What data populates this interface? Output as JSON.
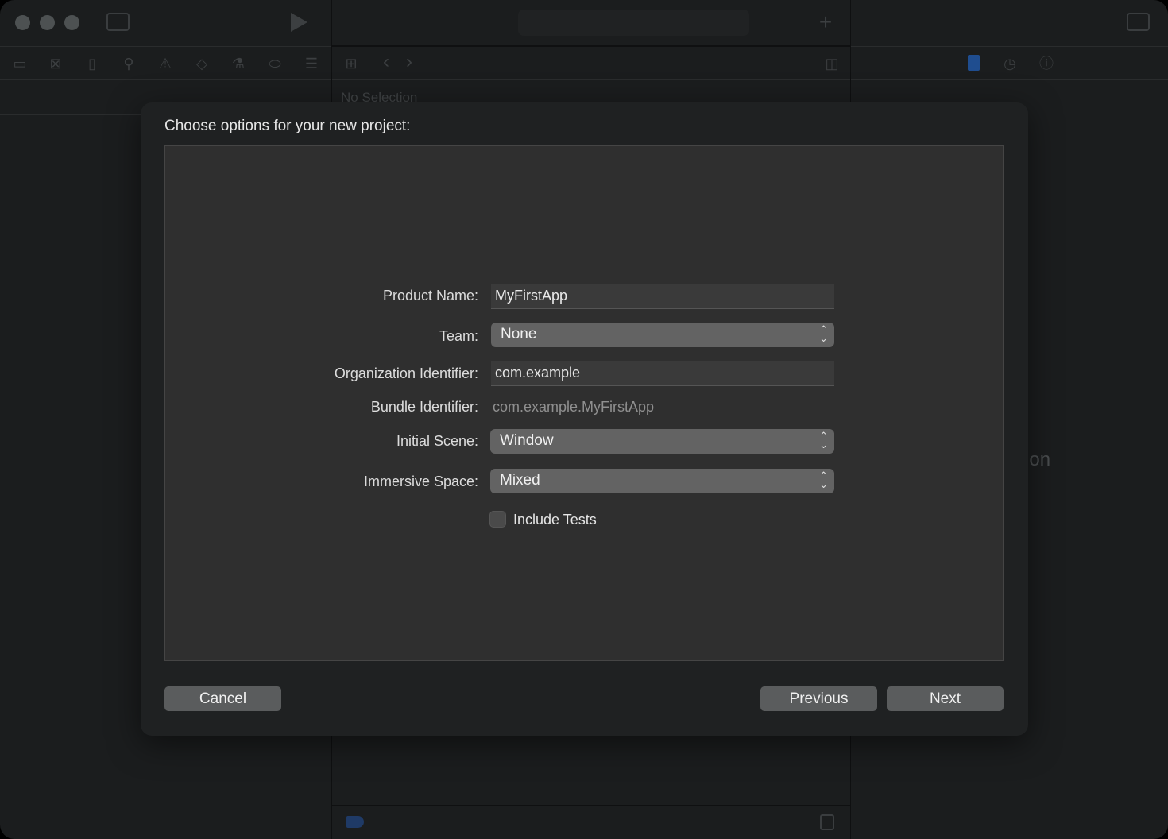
{
  "toolbar": {
    "icons": [
      "sidebar-toggle-icon",
      "run-icon",
      "add-icon",
      "inspector-toggle-icon"
    ]
  },
  "navigator": {
    "icons": [
      "folder-icon",
      "source-control-icon",
      "bookmark-icon",
      "search-icon",
      "warning-icon",
      "test-icon",
      "debug-icon",
      "breakpoint-icon",
      "report-icon"
    ]
  },
  "editor": {
    "no_selection": "No Selection"
  },
  "inspector": {
    "no_selection": "No Selection"
  },
  "dialog": {
    "title": "Choose options for your new project:",
    "product_name": {
      "label": "Product Name:",
      "value": "MyFirstApp"
    },
    "team": {
      "label": "Team:",
      "value": "None"
    },
    "org_id": {
      "label": "Organization Identifier:",
      "value": "com.example"
    },
    "bundle_id": {
      "label": "Bundle Identifier:",
      "value": "com.example.MyFirstApp"
    },
    "initial_scene": {
      "label": "Initial Scene:",
      "value": "Window"
    },
    "immersive_space": {
      "label": "Immersive Space:",
      "value": "Mixed"
    },
    "include_tests": {
      "label": "Include Tests",
      "checked": false
    },
    "cancel": "Cancel",
    "previous": "Previous",
    "next": "Next"
  },
  "colors": {
    "accent": "#1f4d8f",
    "background": "#1b1d1e",
    "dialog": "#1f2122",
    "panel": "#2f2f2f"
  }
}
